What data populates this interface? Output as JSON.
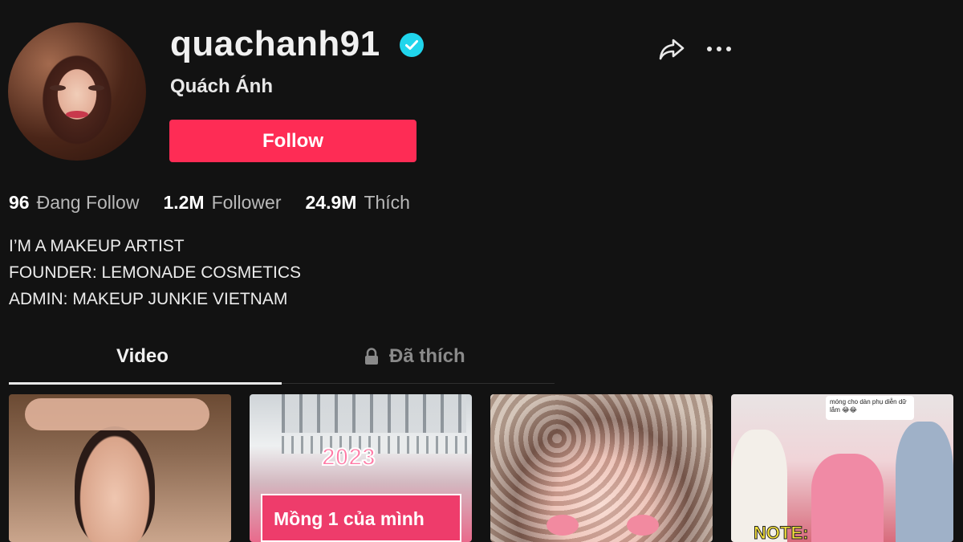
{
  "profile": {
    "username": "quachanh91",
    "nickname": "Quách Ánh",
    "follow_label": "Follow",
    "verified": true
  },
  "stats": {
    "following_count": "96",
    "following_label": "Đang Follow",
    "followers_count": "1.2M",
    "followers_label": "Follower",
    "likes_count": "24.9M",
    "likes_label": "Thích"
  },
  "bio": "I’M A MAKEUP ARTIST\nFOUNDER: LEMONADE COSMETICS\nADMIN: MAKEUP JUNKIE VIETNAM",
  "tabs": {
    "video": "Video",
    "liked": "Đã thích"
  },
  "videos": {
    "v2_year": "2023",
    "v2_caption": "Mồng 1 của mình",
    "v4_bubble": "móng cho dàn phụ diễn dữ lắm 😂😂",
    "v4_note": "NOTE:"
  },
  "colors": {
    "background": "#121212",
    "follow_button": "#fe2c55",
    "verified_badge": "#20d5ec"
  },
  "icons": [
    "verified-icon",
    "share-icon",
    "more-icon",
    "lock-icon"
  ]
}
